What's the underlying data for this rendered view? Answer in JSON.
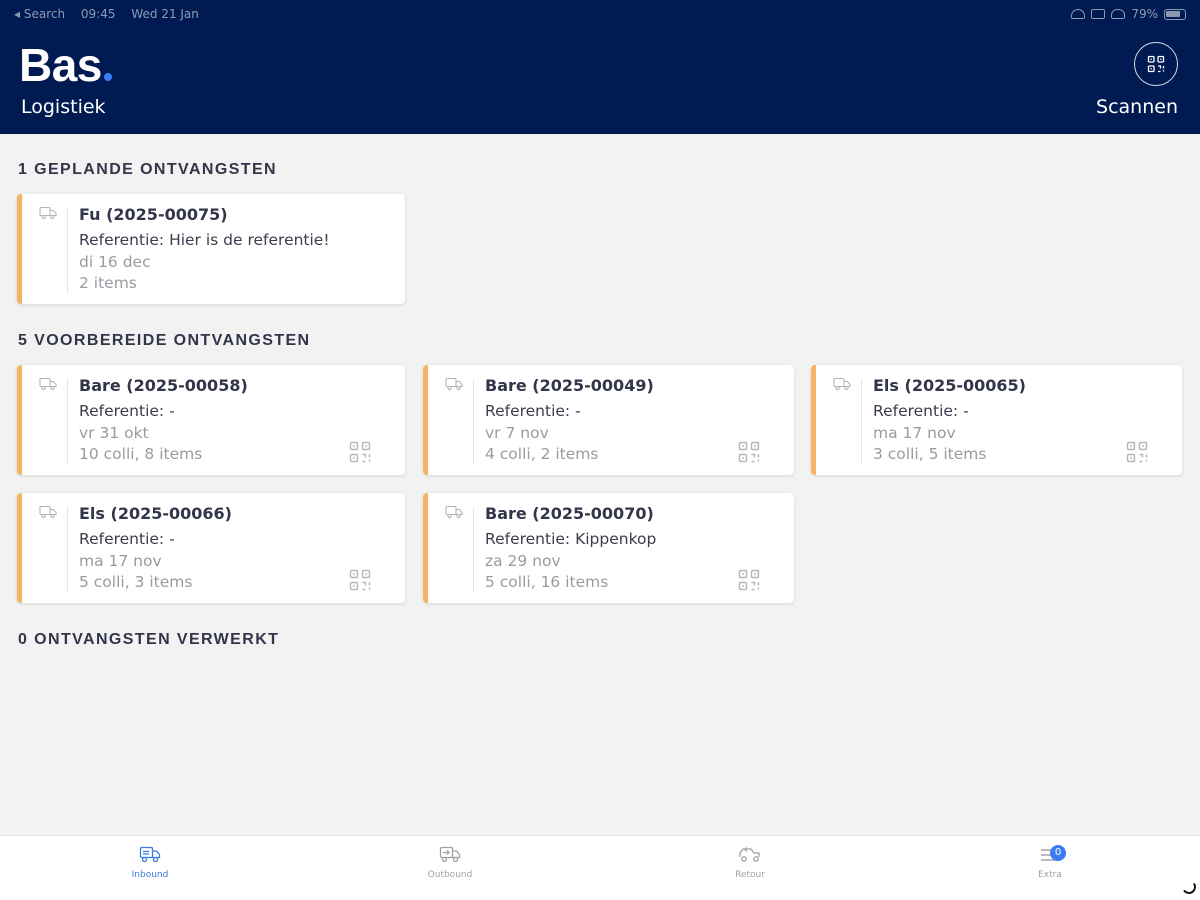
{
  "status_bar": {
    "back": "◂ Search",
    "time": "09:45",
    "date": "Wed 21 Jan",
    "battery": "79%"
  },
  "header": {
    "logo": "Bas",
    "subtitle": "Logistiek",
    "scan_label": "Scannen",
    "background": "#001a52",
    "accent": "#3b7cf5"
  },
  "sections": {
    "planned": {
      "title": "1 GEPLANDE ONTVANGSTEN"
    },
    "prepared": {
      "title": "5 VOORBEREIDE ONTVANGSTEN"
    },
    "processed": {
      "title": "0 ONTVANGSTEN VERWERKT"
    }
  },
  "planned_cards": [
    {
      "title": "Fu (2025-00075)",
      "reference": "Referentie: Hier is de referentie!",
      "date": "di 16 dec",
      "count": "2 items"
    }
  ],
  "prepared_cards": [
    {
      "title": "Bare (2025-00058)",
      "reference": "Referentie: -",
      "date": "vr 31 okt",
      "count": "10 colli, 8 items"
    },
    {
      "title": "Bare (2025-00049)",
      "reference": "Referentie: -",
      "date": "vr 7 nov",
      "count": "4 colli, 2 items"
    },
    {
      "title": "Els (2025-00065)",
      "reference": "Referentie: -",
      "date": "ma 17 nov",
      "count": "3 colli, 5 items"
    },
    {
      "title": "Els (2025-00066)",
      "reference": "Referentie: -",
      "date": "ma 17 nov",
      "count": "5 colli, 3 items"
    },
    {
      "title": "Bare (2025-00070)",
      "reference": "Referentie: Kippenkop",
      "date": "za 29 nov",
      "count": "5 colli, 16 items"
    }
  ],
  "card_accent": "#f5b36a",
  "tabs": [
    {
      "label": "Inbound",
      "icon": "truck-inbound-icon",
      "active": true
    },
    {
      "label": "Outbound",
      "icon": "truck-outbound-icon",
      "active": false
    },
    {
      "label": "Retour",
      "icon": "truck-return-icon",
      "active": false
    },
    {
      "label": "Extra",
      "icon": "menu-icon",
      "active": false,
      "badge": "0"
    }
  ]
}
